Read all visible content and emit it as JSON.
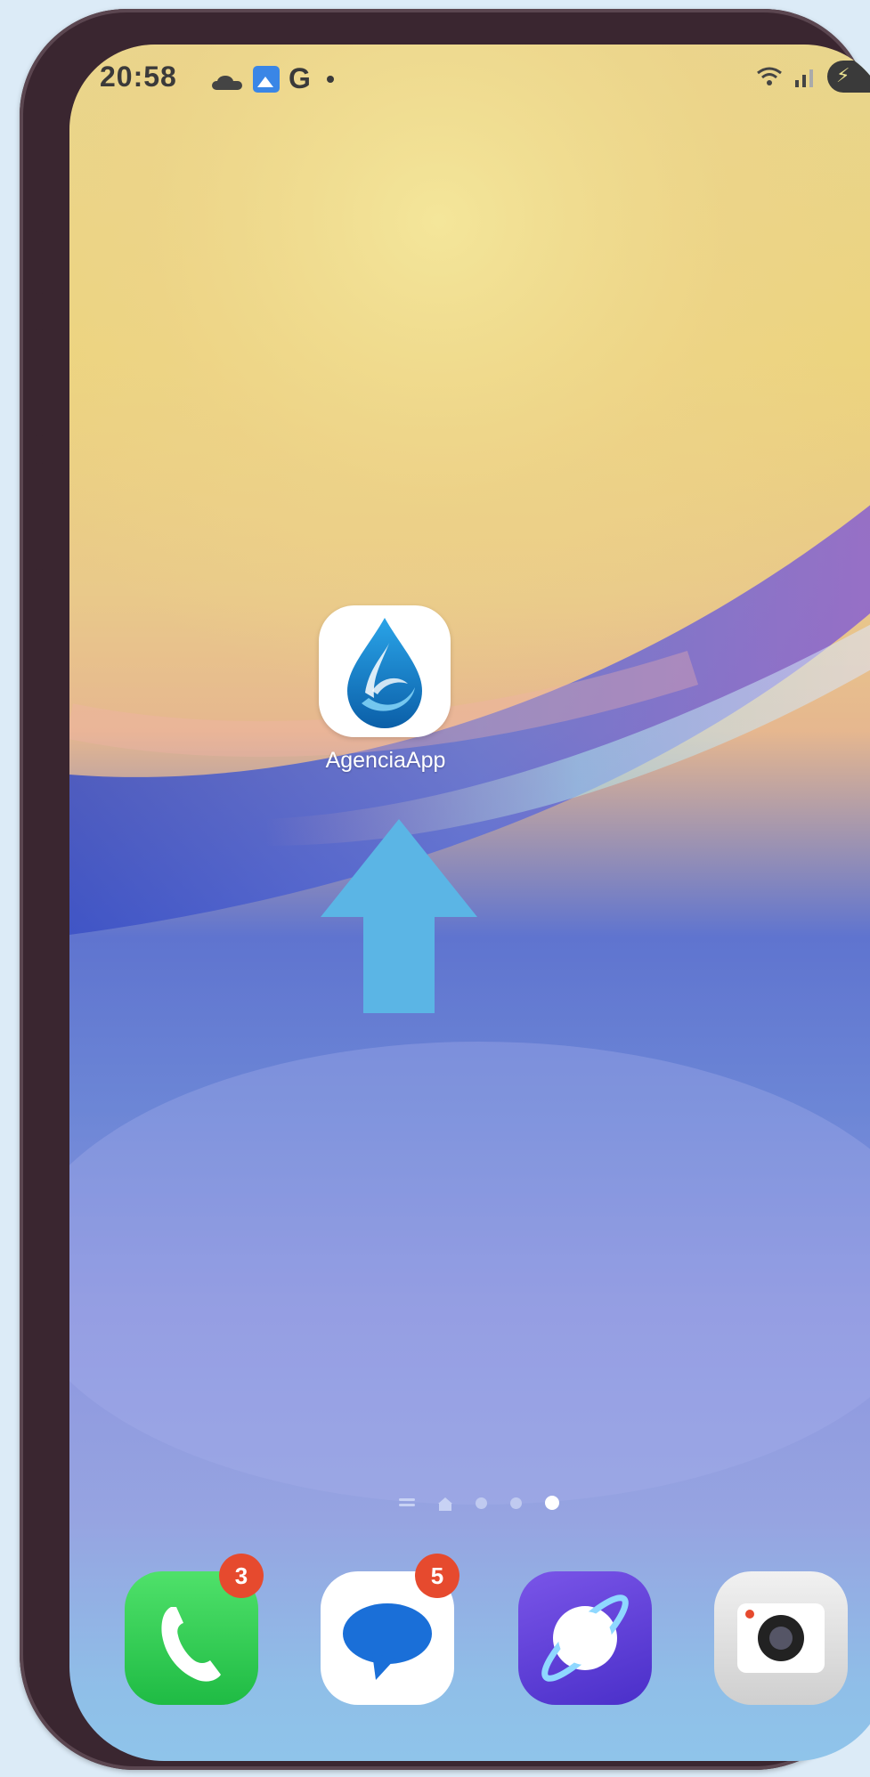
{
  "status_bar": {
    "time": "20:58",
    "left_icons": [
      "cloud-icon",
      "gallery-icon",
      "google-g-icon",
      "notification-dot-icon"
    ],
    "g_letter": "G",
    "right_icons": [
      "wifi-icon",
      "signal-icon",
      "battery-charging-icon"
    ]
  },
  "home": {
    "app": {
      "label": "AgenciaApp",
      "icon": "water-drop-logo-icon"
    },
    "arrow": {
      "icon": "up-arrow-icon",
      "color": "#5bb5e5"
    }
  },
  "page_indicator": {
    "pages": 4,
    "active_index": 3
  },
  "dock": [
    {
      "name": "phone",
      "icon": "phone-icon",
      "badge": "3"
    },
    {
      "name": "messages",
      "icon": "messages-icon",
      "badge": "5"
    },
    {
      "name": "internet",
      "icon": "internet-browser-icon"
    },
    {
      "name": "camera",
      "icon": "camera-icon"
    }
  ],
  "colors": {
    "badge": "#e64a2e",
    "phone_green": "#22c04a",
    "internet_purple": "#5a3bd8",
    "messages_blue": "#1a6fd8"
  }
}
